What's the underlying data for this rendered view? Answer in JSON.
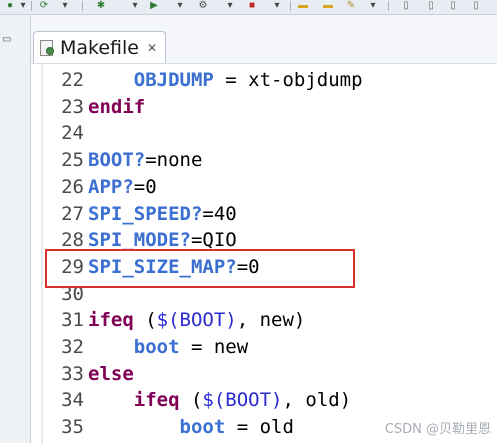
{
  "editor_tab": {
    "label": "Makefile",
    "close": "✕"
  },
  "toolbar": {
    "icons": [
      "run-icon",
      "debug-icon",
      "gear-icon",
      "folder-icon",
      "edit-icon",
      "window-icon"
    ]
  },
  "code_lines": [
    {
      "num": "22",
      "tokens": [
        {
          "t": "    ",
          "c": "plain"
        },
        {
          "t": "OBJDUMP",
          "c": "var"
        },
        {
          "t": " = xt-objdump",
          "c": "plain"
        }
      ]
    },
    {
      "num": "23",
      "tokens": [
        {
          "t": "endif",
          "c": "kw"
        }
      ]
    },
    {
      "num": "24",
      "tokens": []
    },
    {
      "num": "25",
      "tokens": [
        {
          "t": "BOOT?",
          "c": "var"
        },
        {
          "t": "=none",
          "c": "plain"
        }
      ]
    },
    {
      "num": "26",
      "tokens": [
        {
          "t": "APP?",
          "c": "var"
        },
        {
          "t": "=0",
          "c": "plain"
        }
      ]
    },
    {
      "num": "27",
      "tokens": [
        {
          "t": "SPI_SPEED?",
          "c": "var"
        },
        {
          "t": "=40",
          "c": "plain"
        }
      ]
    },
    {
      "num": "28",
      "tokens": [
        {
          "t": "SPI_MODE?",
          "c": "var"
        },
        {
          "t": "=QIO",
          "c": "plain"
        }
      ]
    },
    {
      "num": "29",
      "tokens": [
        {
          "t": "SPI_SIZE_MAP?",
          "c": "var"
        },
        {
          "t": "=0",
          "c": "plain"
        }
      ]
    },
    {
      "num": "30",
      "tokens": []
    },
    {
      "num": "31",
      "tokens": [
        {
          "t": "ifeq",
          "c": "kw"
        },
        {
          "t": " (",
          "c": "plain"
        },
        {
          "t": "$(BOOT)",
          "c": "paren"
        },
        {
          "t": ", new)",
          "c": "plain"
        }
      ]
    },
    {
      "num": "32",
      "tokens": [
        {
          "t": "    ",
          "c": "plain"
        },
        {
          "t": "boot",
          "c": "var"
        },
        {
          "t": " = new",
          "c": "plain"
        }
      ]
    },
    {
      "num": "33",
      "tokens": [
        {
          "t": "else",
          "c": "kw"
        }
      ]
    },
    {
      "num": "34",
      "tokens": [
        {
          "t": "    ",
          "c": "plain"
        },
        {
          "t": "ifeq",
          "c": "kw"
        },
        {
          "t": " (",
          "c": "plain"
        },
        {
          "t": "$(BOOT)",
          "c": "paren"
        },
        {
          "t": ", old)",
          "c": "plain"
        }
      ]
    },
    {
      "num": "35",
      "tokens": [
        {
          "t": "        ",
          "c": "plain"
        },
        {
          "t": "boot",
          "c": "var"
        },
        {
          "t": " = old",
          "c": "plain"
        }
      ]
    }
  ],
  "watermark": "CSDN @贝勒里恩",
  "colors": {
    "keyword": "#7f0055",
    "variable": "#3b6fd1",
    "highlight_box": "#d9302c"
  }
}
